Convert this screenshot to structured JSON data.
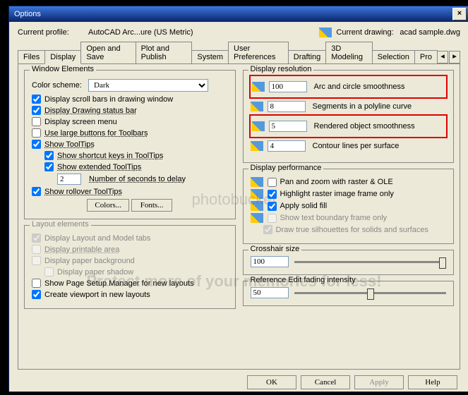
{
  "title": "Options",
  "profile": {
    "label": "Current profile:",
    "value": "AutoCAD Arc...ure (US Metric)"
  },
  "drawing": {
    "label": "Current drawing:",
    "value": "acad sample.dwg"
  },
  "tabs": [
    "Files",
    "Display",
    "Open and Save",
    "Plot and Publish",
    "System",
    "User Preferences",
    "Drafting",
    "3D Modeling",
    "Selection",
    "Pro"
  ],
  "we": {
    "title": "Window Elements",
    "scheme_l": "Color scheme:",
    "scheme_v": "Dark",
    "scroll": "Display scroll bars in drawing window",
    "status": "Display Drawing status bar",
    "screen": "Display screen menu",
    "large": "Use large buttons for Toolbars",
    "tips": "Show ToolTips",
    "shortcut": "Show shortcut keys in ToolTips",
    "ext": "Show extended ToolTips",
    "delay_v": "2",
    "delay_l": "Number of seconds to delay",
    "rollover": "Show rollover ToolTips",
    "colors": "Colors...",
    "fonts": "Fonts..."
  },
  "le": {
    "title": "Layout elements",
    "lm": "Display Layout and Model tabs",
    "pa": "Display printable area",
    "pb": "Display paper background",
    "ps": "Display paper shadow",
    "pm": "Show Page Setup Manager for new layouts",
    "vp": "Create viewport in new layouts"
  },
  "dr": {
    "title": "Display resolution",
    "arc_v": "100",
    "arc_l": "Arc and circle smoothness",
    "seg_v": "8",
    "seg_l": "Segments in a polyline curve",
    "ren_v": "5",
    "ren_l": "Rendered object smoothness",
    "con_v": "4",
    "con_l": "Contour lines per surface"
  },
  "dp": {
    "title": "Display performance",
    "pan": "Pan and zoom with raster & OLE",
    "hl": "Highlight raster image frame only",
    "fill": "Apply solid fill",
    "txt": "Show text boundary frame only",
    "sil": "Draw true silhouettes for solids and surfaces"
  },
  "ch": {
    "title": "Crosshair size",
    "v": "100"
  },
  "ref": {
    "title": "Reference Edit fading intensity",
    "v": "50"
  },
  "b": {
    "ok": "OK",
    "cancel": "Cancel",
    "apply": "Apply",
    "help": "Help"
  },
  "wm1": "photobucket",
  "wm2": "Protect more of your memories for less!"
}
